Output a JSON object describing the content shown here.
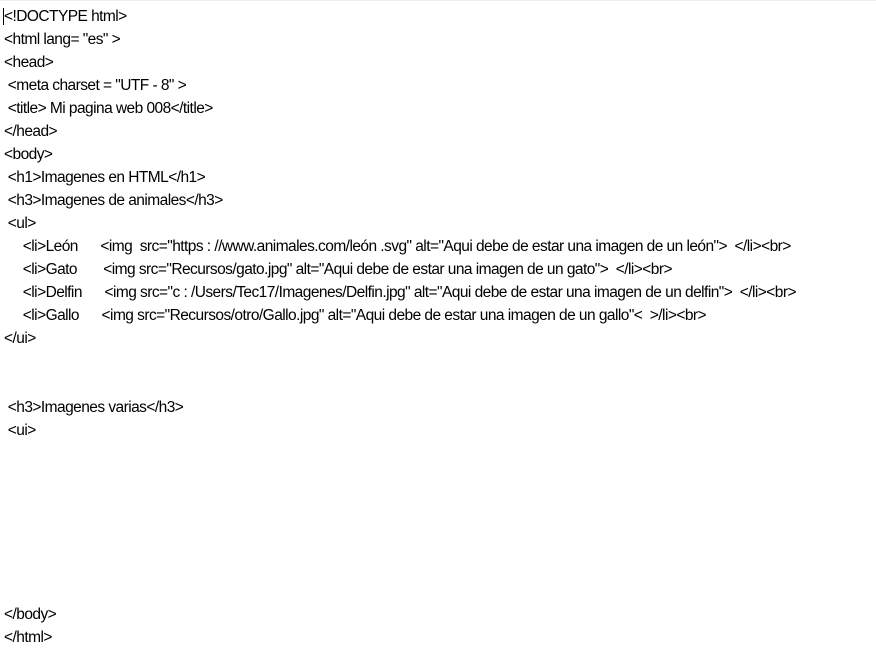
{
  "document": {
    "lines": [
      "<!DOCTYPE html>",
      "<html lang= \"es\" >",
      "<head>",
      " <meta charset = \"UTF - 8\" >",
      " <title> Mi pagina web 008</title>",
      "</head>",
      "<body>",
      " <h1>Imagenes en HTML</h1>",
      " <h3>Imagenes de animales</h3>",
      " <ul>",
      "     <li>León      <img  src=\"https : //www.animales.com/león .svg\" alt=\"Aqui debe de estar una imagen de un león\">  </li><br>",
      "     <li>Gato       <img src=\"Recursos/gato.jpg\" alt=\"Aqui debe de estar una imagen de un gato\">  </li><br>",
      "     <li>Delfin      <img src=\"c : /Users/Tec17/Imagenes/Delfin.jpg\" alt=\"Aqui debe de estar una imagen de un delfin\">  </li><br>",
      "     <li>Gallo      <img src=\"Recursos/otro/Gallo.jpg\" alt=\"Aqui debe de estar una imagen de un gallo\"<  >/li><br>",
      "</ui>",
      " <h3>Imagenes varias</h3>",
      " <ui>",
      "</body>",
      "</html>"
    ]
  }
}
